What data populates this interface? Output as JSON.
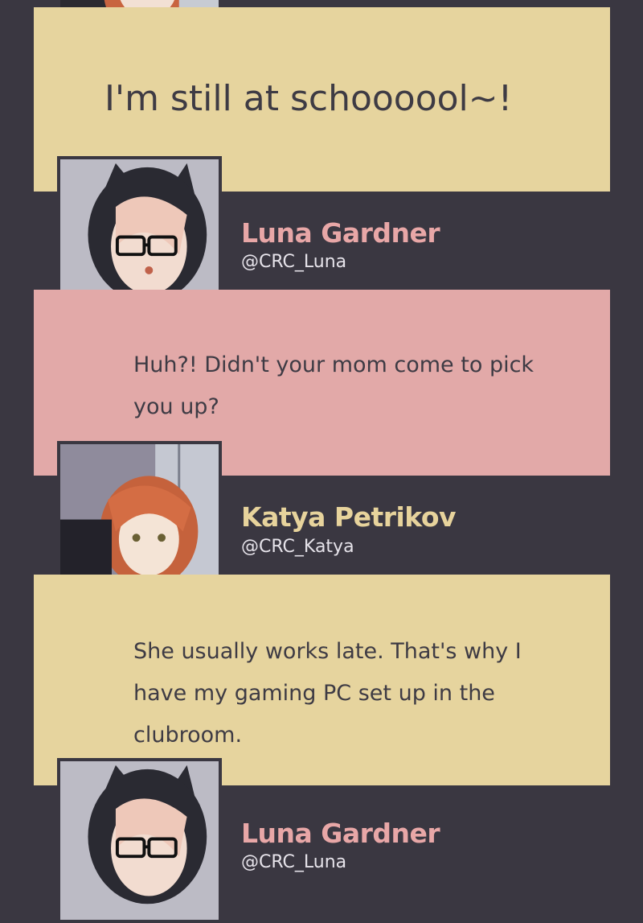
{
  "thread": [
    {
      "id": "m1",
      "text": "I'm still at schoooool~!"
    },
    {
      "id": "m2",
      "author": {
        "name": "Luna Gardner",
        "handle": "@CRC_Luna",
        "avatar": "cat-hood-glasses-girl-avatar"
      },
      "text": "Huh?! Didn't your mom come to pick you up?"
    },
    {
      "id": "m3",
      "author": {
        "name": "Katya Petrikov",
        "handle": "@CRC_Katya",
        "avatar": "red-hair-pc-girl-avatar"
      },
      "text": "She usually works late. That's why I have my gaming PC set up in the clubroom."
    },
    {
      "id": "m4",
      "author": {
        "name": "Luna Gardner",
        "handle": "@CRC_Luna",
        "avatar": "cat-hood-glasses-girl-avatar"
      }
    }
  ],
  "colors": {
    "background": "#3a3741",
    "bubble_yellow": "#e6d49e",
    "bubble_pink": "#e2a9a8",
    "name_luna": "#e8a7a7",
    "name_katya": "#e7d39c",
    "text": "#3e3b44"
  }
}
